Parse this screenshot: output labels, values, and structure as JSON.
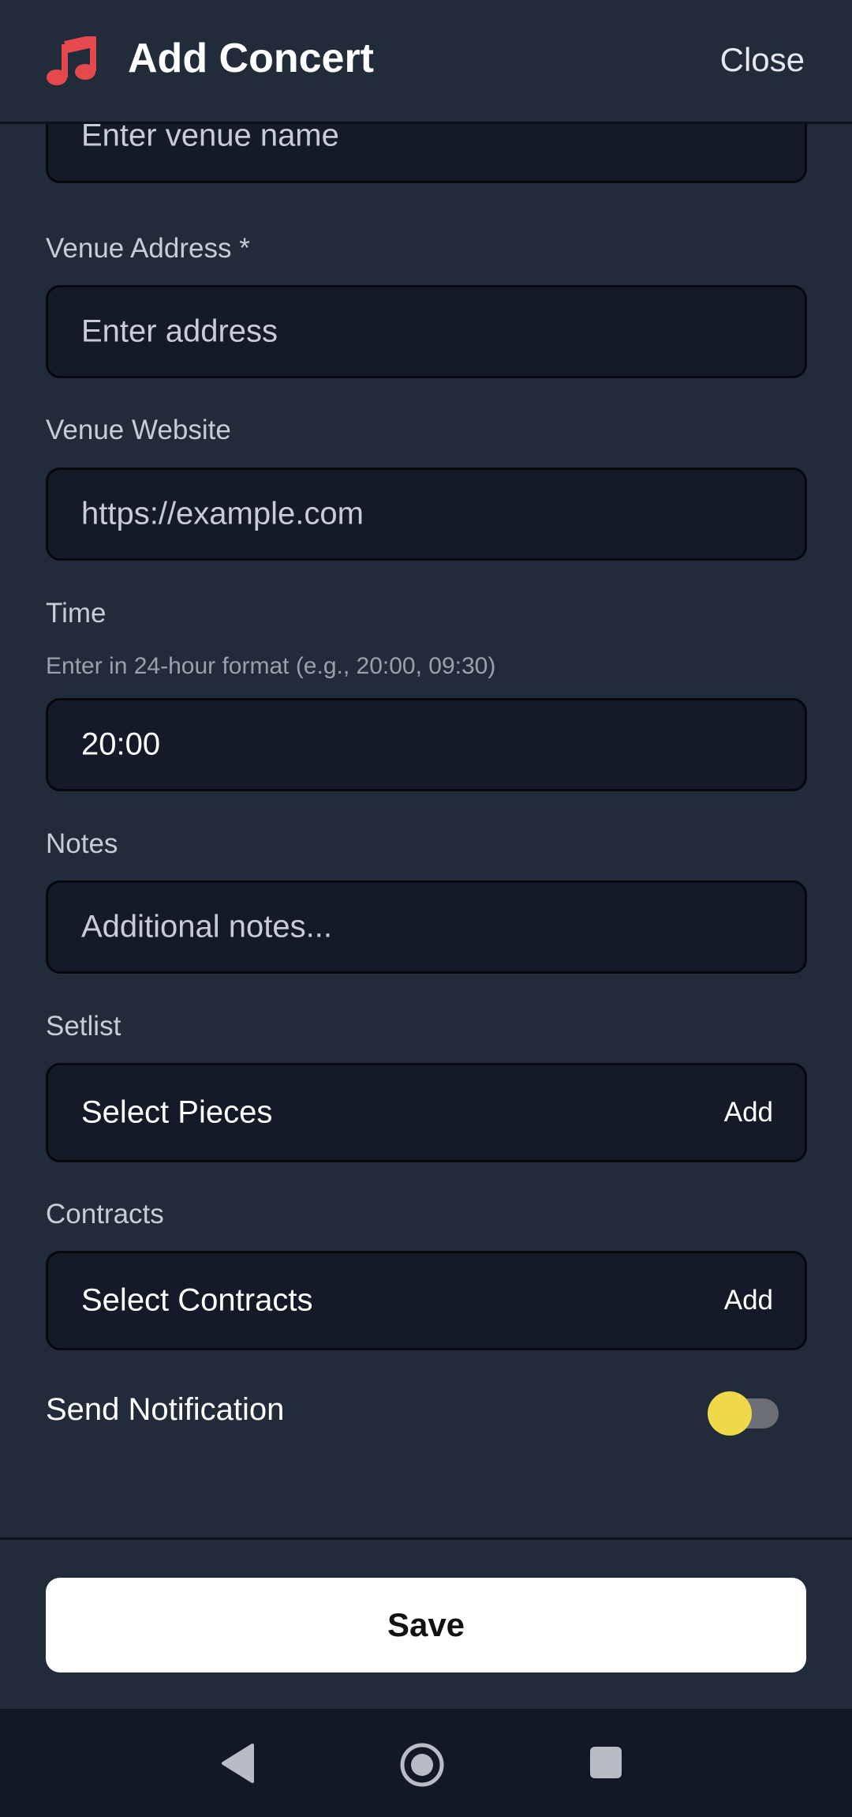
{
  "header": {
    "title": "Add Concert",
    "close_label": "Close",
    "icon": "music-note-icon",
    "accent_color": "#e5484d"
  },
  "form": {
    "venue_name": {
      "placeholder": "Enter venue name"
    },
    "venue_address": {
      "label": "Venue Address *",
      "placeholder": "Enter address"
    },
    "venue_website": {
      "label": "Venue Website",
      "placeholder": "https://example.com"
    },
    "time": {
      "label": "Time",
      "hint": "Enter in 24-hour format (e.g., 20:00, 09:30)",
      "value": "20:00"
    },
    "notes": {
      "label": "Notes",
      "placeholder": "Additional notes..."
    },
    "setlist": {
      "label": "Setlist",
      "text": "Select Pieces",
      "add_label": "Add"
    },
    "contracts": {
      "label": "Contracts",
      "text": "Select Contracts",
      "add_label": "Add"
    },
    "notification": {
      "label": "Send Notification",
      "enabled": false,
      "toggle_color": "#efd84a"
    }
  },
  "footer": {
    "save_label": "Save"
  },
  "navbar": {
    "icons": [
      "back-icon",
      "home-icon",
      "recents-icon"
    ]
  }
}
